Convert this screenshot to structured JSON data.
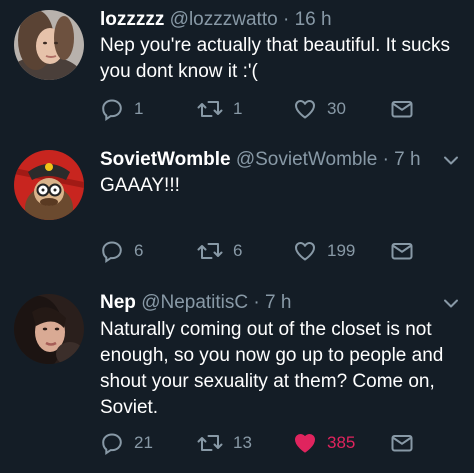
{
  "tweets": [
    {
      "display_name": "lozzzzz",
      "handle": "@lozzzwatto",
      "separator": "·",
      "time": "16 h",
      "text": "Nep you're actually that beautiful. It sucks you dont know it :'(",
      "replies": "1",
      "retweets": "1",
      "likes": "30",
      "liked": false
    },
    {
      "display_name": "SovietWomble",
      "handle": "@SovietWomble",
      "separator": "·",
      "time": "7 h",
      "text": "GAAAY!!!",
      "replies": "6",
      "retweets": "6",
      "likes": "199",
      "liked": false
    },
    {
      "display_name": "Nep",
      "handle": "@NepatitisC",
      "separator": "·",
      "time": "7 h",
      "text": "Naturally coming out of the closet is not enough, so you now go up to people and shout your sexuality at them? Come on, Soviet.",
      "replies": "21",
      "retweets": "13",
      "likes": "385",
      "liked": true
    }
  ],
  "icons": {
    "reply": "reply-icon",
    "retweet": "retweet-icon",
    "like": "heart-icon",
    "message": "direct-message-icon",
    "menu": "chevron-down-icon"
  },
  "colors": {
    "background": "#141d26",
    "muted": "#8899a6",
    "like_active": "#e0245e"
  }
}
